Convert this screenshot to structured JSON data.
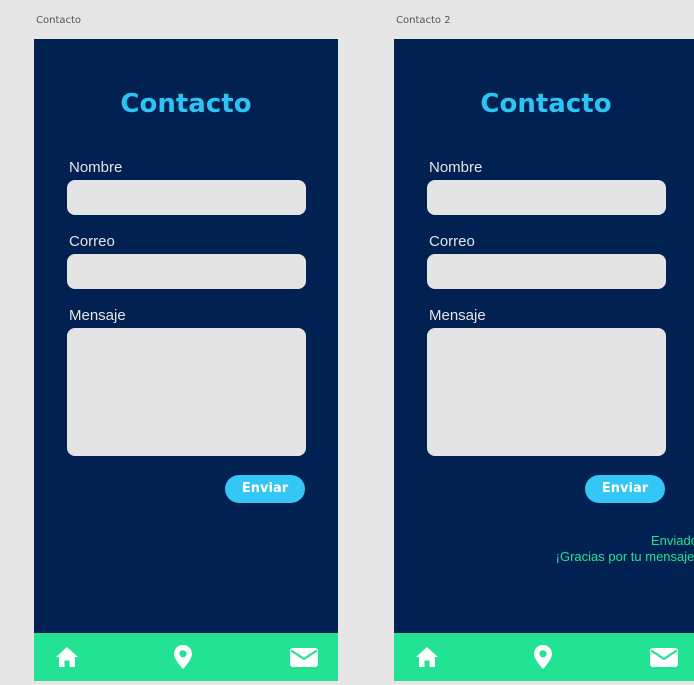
{
  "artboards": [
    {
      "label": "Contacto",
      "title": "Contacto",
      "form": {
        "name_label": "Nombre",
        "name_value": "",
        "email_label": "Correo",
        "email_value": "",
        "message_label": "Mensaje",
        "message_value": ""
      },
      "send_label": "Enviar",
      "tabbar": {
        "icons": [
          "home-icon",
          "location-pin-icon",
          "mail-icon"
        ]
      }
    },
    {
      "label": "Contacto 2",
      "title": "Contacto",
      "form": {
        "name_label": "Nombre",
        "name_value": "",
        "email_label": "Correo",
        "email_value": "",
        "message_label": "Mensaje",
        "message_value": ""
      },
      "send_label": "Enviar",
      "confirmation": {
        "line1": "Enviado",
        "line2": "¡Gracias por tu mensaje!"
      },
      "tabbar": {
        "icons": [
          "home-icon",
          "location-pin-icon",
          "mail-icon"
        ]
      }
    }
  ],
  "colors": {
    "background": "#002152",
    "accent": "#2bc4f3",
    "tabbar": "#22e394",
    "field": "#e4e4e4",
    "success_text": "#22e394"
  }
}
